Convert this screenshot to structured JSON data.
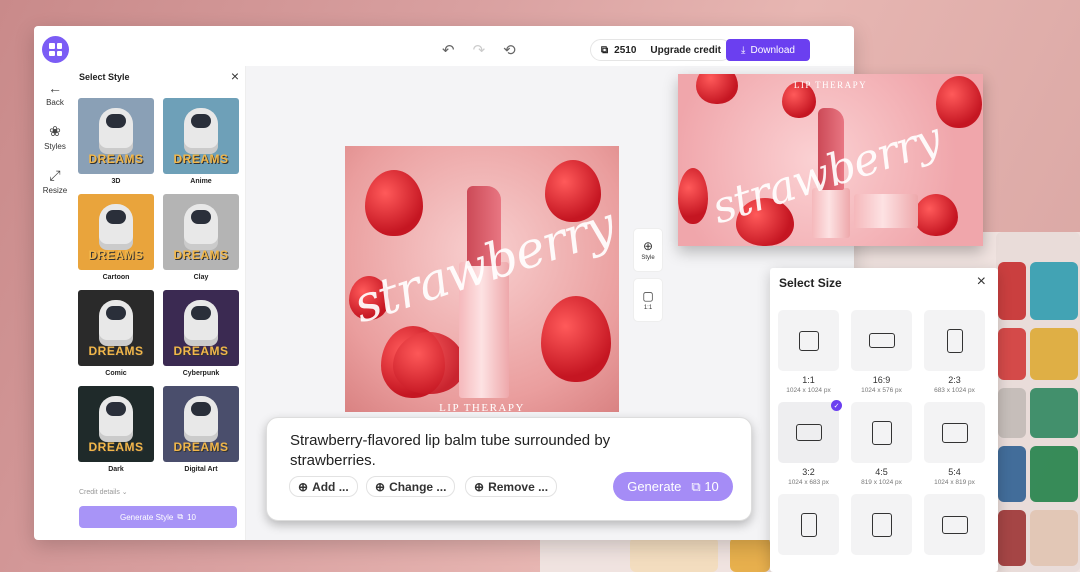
{
  "toolbar": {
    "credits": "2510",
    "upgrade_label": "Upgrade credit",
    "download_label": "Download"
  },
  "nav": {
    "back": "Back",
    "styles": "Styles",
    "resize": "Resize"
  },
  "style_panel": {
    "title": "Select Style",
    "thumb_word": "DREAMS",
    "items": [
      {
        "label": "3D",
        "bg": "#8aa0b6"
      },
      {
        "label": "Anime",
        "bg": "#6ea0b8"
      },
      {
        "label": "Cartoon",
        "bg": "#e9a43c"
      },
      {
        "label": "Clay",
        "bg": "#b4b4b4"
      },
      {
        "label": "Comic",
        "bg": "#2a2a2a"
      },
      {
        "label": "Cyberpunk",
        "bg": "#3b2a52"
      },
      {
        "label": "Dark",
        "bg": "#1f2a2a"
      },
      {
        "label": "Digital Art",
        "bg": "#4a4e6c"
      }
    ],
    "credit_details": "Credit details",
    "generate_label": "Generate Style",
    "generate_cost": "10"
  },
  "canvas": {
    "image_word": "strawberry",
    "image_caption": "LIP THERAPY",
    "tools": {
      "style": "Style",
      "ratio": "1:1"
    }
  },
  "prompt": {
    "text": "Strawberry-flavored lip balm tube surrounded by strawberries.",
    "chips": [
      "Add ...",
      "Change ...",
      "Remove ..."
    ],
    "generate_label": "Generate",
    "generate_cost": "10"
  },
  "preview": {
    "word": "strawberry",
    "caption": "LIP THERAPY"
  },
  "size_panel": {
    "title": "Select Size",
    "sizes": [
      {
        "ratio": "1:1",
        "dims": "1024 x 1024 px"
      },
      {
        "ratio": "16:9",
        "dims": "1024 x 576 px"
      },
      {
        "ratio": "2:3",
        "dims": "683 x 1024 px"
      },
      {
        "ratio": "3:2",
        "dims": "1024 x 683 px"
      },
      {
        "ratio": "4:5",
        "dims": "819 x 1024 px"
      },
      {
        "ratio": "5:4",
        "dims": "1024 x 819 px"
      },
      {
        "ratio": "",
        "dims": ""
      },
      {
        "ratio": "",
        "dims": ""
      },
      {
        "ratio": "",
        "dims": ""
      }
    ],
    "selected": "3:2"
  },
  "colors": {
    "accent": "#6b3ff0",
    "accent_light": "#a58cf6"
  }
}
